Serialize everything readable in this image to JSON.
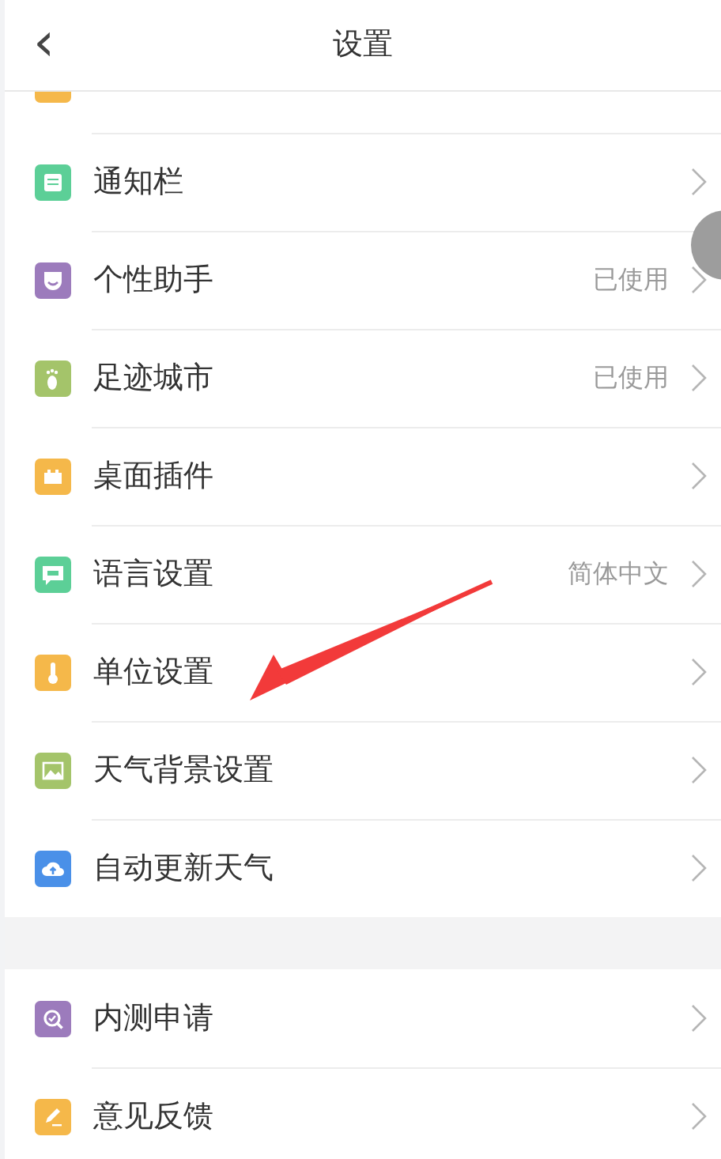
{
  "header": {
    "title": "设置",
    "back": "‹"
  },
  "sections": [
    {
      "items": [
        {
          "kind": "partial",
          "color": "#f5b84a"
        },
        {
          "label": "通知栏",
          "color": "#5ccf97"
        },
        {
          "label": "个性助手",
          "value": "已使用",
          "color": "#9c7bbc"
        },
        {
          "label": "足迹城市",
          "value": "已使用",
          "color": "#a4c46a"
        },
        {
          "label": "桌面插件",
          "color": "#f5b84a"
        },
        {
          "label": "语言设置",
          "value": "简体中文",
          "color": "#5ccf97"
        },
        {
          "label": "单位设置",
          "color": "#f5b84a"
        },
        {
          "label": "天气背景设置",
          "color": "#a4c46a"
        },
        {
          "label": "自动更新天气",
          "color": "#4a90e8"
        }
      ]
    },
    {
      "items": [
        {
          "label": "内测申请",
          "color": "#9c7bbc"
        },
        {
          "label": "意见反馈",
          "color": "#f5b84a"
        }
      ]
    }
  ],
  "annotation": {
    "kind": "arrow",
    "color": "#f23a3a"
  }
}
